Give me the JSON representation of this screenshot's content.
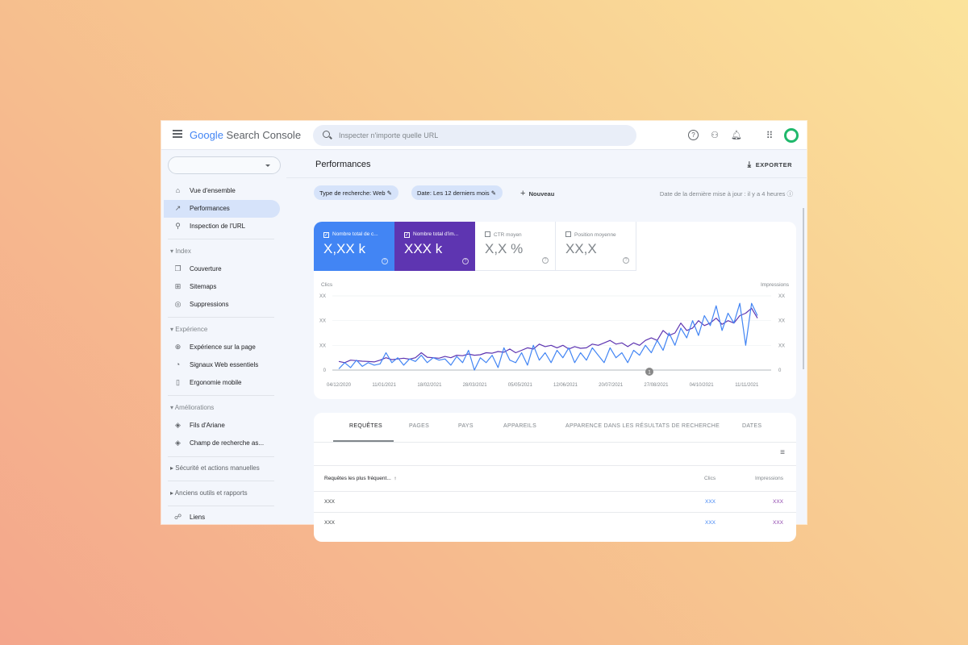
{
  "app": {
    "logo_google": "Google",
    "logo_product": "Search Console",
    "search_placeholder": "Inspecter n'importe quelle URL"
  },
  "topbar_icons": [
    "help-icon",
    "manage-users-icon",
    "bell-icon",
    "apps-grid-icon",
    "account-avatar"
  ],
  "sidebar": {
    "property_selector": "",
    "items": [
      {
        "label": "Vue d'ensemble",
        "icon": "home-icon",
        "active": false
      },
      {
        "label": "Performances",
        "icon": "trending-up-icon",
        "active": true
      },
      {
        "label": "Inspection de l'URL",
        "icon": "search-icon",
        "active": false
      }
    ],
    "sections": [
      {
        "title": "Index",
        "expanded": true,
        "items": [
          {
            "label": "Couverture",
            "icon": "copy-icon"
          },
          {
            "label": "Sitemaps",
            "icon": "sitemap-icon"
          },
          {
            "label": "Suppressions",
            "icon": "eye-off-icon"
          }
        ]
      },
      {
        "title": "Expérience",
        "expanded": true,
        "items": [
          {
            "label": "Expérience sur la page",
            "icon": "plus-circle-icon"
          },
          {
            "label": "Signaux Web essentiels",
            "icon": "gauge-icon"
          },
          {
            "label": "Ergonomie mobile",
            "icon": "phone-icon"
          }
        ]
      },
      {
        "title": "Améliorations",
        "expanded": true,
        "items": [
          {
            "label": "Fils d'Ariane",
            "icon": "layers-icon"
          },
          {
            "label": "Champ de recherche as...",
            "icon": "layers-icon"
          }
        ]
      },
      {
        "title": "Sécurité et actions manuelles",
        "expanded": false,
        "items": []
      },
      {
        "title": "Anciens outils et rapports",
        "expanded": false,
        "items": []
      }
    ],
    "links": {
      "label": "Liens",
      "icon": "network-icon"
    }
  },
  "main": {
    "title": "Performances",
    "export_label": "EXPORTER",
    "filters": [
      {
        "label": "Type de recherche: Web"
      },
      {
        "label": "Date: Les 12 derniers mois"
      }
    ],
    "new_label": "Nouveau",
    "updated": "Date de la dernière mise à jour : il y a 4 heures",
    "metrics": [
      {
        "label": "Nombre total de c...",
        "value": "X,XX k",
        "checked": true,
        "color": "#4285f4"
      },
      {
        "label": "Nombre total d'im...",
        "value": "XXX k",
        "checked": true,
        "color": "#5e35b1"
      },
      {
        "label": "CTR moyen",
        "value": "X,X %",
        "checked": false
      },
      {
        "label": "Position moyenne",
        "value": "XX,X",
        "checked": false
      }
    ],
    "tabs": [
      "REQUÊTES",
      "PAGES",
      "PAYS",
      "APPAREILS",
      "APPARENCE DANS LES RÉSULTATS DE RECHERCHE",
      "DATES"
    ],
    "active_tab": 0,
    "table": {
      "headers": [
        "Requêtes les plus fréquent...",
        "Clics",
        "Impressions"
      ],
      "sort": "arrow-up-icon",
      "rows": [
        [
          "XXX",
          "XXX",
          "XXX"
        ],
        [
          "XXX",
          "XXX",
          "XXX"
        ]
      ]
    }
  },
  "chart_data": {
    "type": "line",
    "left_axis_label": "Clics",
    "right_axis_label": "Impressions",
    "y_tick_labels": [
      "0",
      "XX",
      "XX",
      "XX"
    ],
    "right_tick_labels": [
      "0",
      "XX",
      "XX",
      "XX"
    ],
    "ylim": [
      0,
      3
    ],
    "x_tick_labels": [
      "04/12/2020",
      "11/01/2021",
      "18/02/2021",
      "28/03/2021",
      "05/05/2021",
      "12/06/2021",
      "20/07/2021",
      "27/08/2021",
      "04/10/2021",
      "11/11/2021"
    ],
    "grid": true,
    "annotation": {
      "label": "1",
      "near": "27/08/2021"
    },
    "series": [
      {
        "name": "Clics",
        "color": "#4285f4",
        "values": [
          0.05,
          0.3,
          0.1,
          0.4,
          0.15,
          0.3,
          0.2,
          0.25,
          0.7,
          0.3,
          0.5,
          0.2,
          0.45,
          0.35,
          0.6,
          0.3,
          0.5,
          0.4,
          0.45,
          0.2,
          0.55,
          0.3,
          0.8,
          0.0,
          0.5,
          0.3,
          0.6,
          0.1,
          0.9,
          0.4,
          0.3,
          0.7,
          0.2,
          1.0,
          0.4,
          0.7,
          0.3,
          0.8,
          0.5,
          0.9,
          0.3,
          0.7,
          0.4,
          0.9,
          0.6,
          0.3,
          0.9,
          0.5,
          0.7,
          0.3,
          0.8,
          0.6,
          1.0,
          0.7,
          1.2,
          0.8,
          1.5,
          1.0,
          1.7,
          1.3,
          2.0,
          1.4,
          2.2,
          1.8,
          2.6,
          1.6,
          2.3,
          1.9,
          2.7,
          1.0,
          2.7,
          2.2
        ]
      },
      {
        "name": "Impressions",
        "color": "#5e35b1",
        "values": [
          0.35,
          0.3,
          0.4,
          0.38,
          0.36,
          0.35,
          0.33,
          0.4,
          0.5,
          0.42,
          0.45,
          0.48,
          0.44,
          0.5,
          0.7,
          0.52,
          0.5,
          0.48,
          0.55,
          0.5,
          0.6,
          0.58,
          0.65,
          0.6,
          0.62,
          0.7,
          0.68,
          0.75,
          0.72,
          0.85,
          0.7,
          0.8,
          0.9,
          0.85,
          1.05,
          0.95,
          1.0,
          0.9,
          1.0,
          0.85,
          0.95,
          0.88,
          0.9,
          1.05,
          1.0,
          1.1,
          1.2,
          1.05,
          1.1,
          0.95,
          1.1,
          1.0,
          1.2,
          1.3,
          1.2,
          1.6,
          1.4,
          1.5,
          1.9,
          1.6,
          1.7,
          2.0,
          1.8,
          1.9,
          2.1,
          1.85,
          2.0,
          1.9,
          2.2,
          2.3,
          2.5,
          2.1
        ]
      }
    ]
  }
}
